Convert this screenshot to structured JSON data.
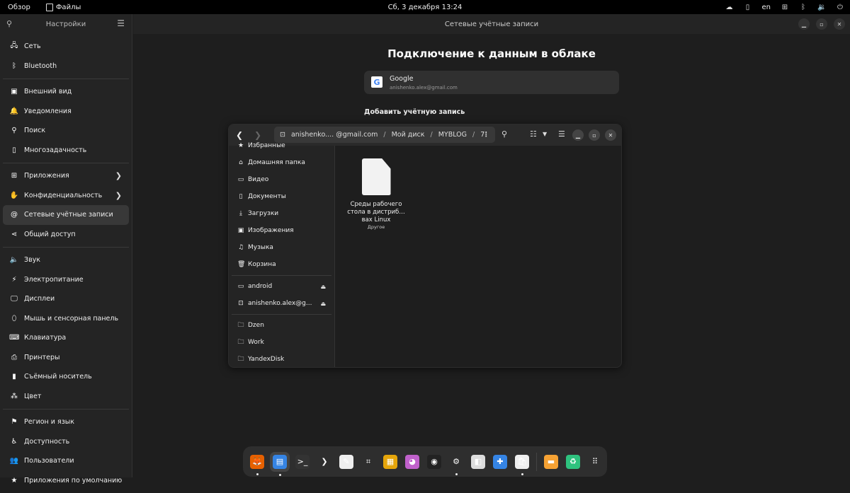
{
  "topbar": {
    "overview": "Обзор",
    "app_name": "Файлы",
    "clock": "Сб, 3 декабря  13:24",
    "lang": "en",
    "tray_icons": [
      "weather-icon",
      "clipboard-icon",
      "network-icon",
      "bluetooth-icon",
      "volume-icon",
      "power-icon"
    ]
  },
  "settings": {
    "title": "Настройки",
    "groups": [
      [
        {
          "label": "Сеть",
          "icon": "network-icon",
          "glyph": "🖧"
        },
        {
          "label": "Bluetooth",
          "icon": "bluetooth-icon",
          "glyph": "ᛒ"
        }
      ],
      [
        {
          "label": "Внешний вид",
          "icon": "appearance-icon",
          "glyph": "▣"
        },
        {
          "label": "Уведомления",
          "icon": "bell-icon",
          "glyph": "🔔"
        },
        {
          "label": "Поиск",
          "icon": "search-icon",
          "glyph": "⚲"
        },
        {
          "label": "Многозадачность",
          "icon": "multitasking-icon",
          "glyph": "▯"
        }
      ],
      [
        {
          "label": "Приложения",
          "icon": "apps-icon",
          "glyph": "⊞",
          "chevron": true
        },
        {
          "label": "Конфиденциальность",
          "icon": "hand-icon",
          "glyph": "✋",
          "chevron": true
        },
        {
          "label": "Сетевые учётные записи",
          "icon": "at-icon",
          "glyph": "@",
          "active": true
        },
        {
          "label": "Общий доступ",
          "icon": "share-icon",
          "glyph": "⋖"
        }
      ],
      [
        {
          "label": "Звук",
          "icon": "speaker-icon",
          "glyph": "🔈"
        },
        {
          "label": "Электропитание",
          "icon": "power-icon",
          "glyph": "⚡"
        },
        {
          "label": "Дисплеи",
          "icon": "display-icon",
          "glyph": "🖵"
        },
        {
          "label": "Мышь и сенсорная панель",
          "icon": "mouse-icon",
          "glyph": "⬯"
        },
        {
          "label": "Клавиатура",
          "icon": "keyboard-icon",
          "glyph": "⌨"
        },
        {
          "label": "Принтеры",
          "icon": "printer-icon",
          "glyph": "⎙"
        },
        {
          "label": "Съёмный носитель",
          "icon": "usb-icon",
          "glyph": "▮"
        },
        {
          "label": "Цвет",
          "icon": "color-icon",
          "glyph": "⁂"
        }
      ],
      [
        {
          "label": "Регион и язык",
          "icon": "flag-icon",
          "glyph": "⚑"
        },
        {
          "label": "Доступность",
          "icon": "accessibility-icon",
          "glyph": "♿"
        },
        {
          "label": "Пользователи",
          "icon": "users-icon",
          "glyph": "👥"
        },
        {
          "label": "Приложения по умолчанию",
          "icon": "star-icon",
          "glyph": "★"
        }
      ]
    ]
  },
  "main": {
    "header": "Сетевые учётные записи",
    "title": "Подключение к данным в облаке",
    "account": {
      "provider": "Google",
      "email": "anishenko.alex@gmail.com"
    },
    "add_label": "Добавить учётную запись"
  },
  "files": {
    "path": [
      "anishenko.... @gmail.com",
      "Мой диск",
      "MYBLOG",
      "7"
    ],
    "sidebar_top": [
      {
        "label": "Избранные",
        "icon": "star-icon",
        "glyph": "★"
      },
      {
        "label": "Домашняя папка",
        "icon": "home-icon",
        "glyph": "⌂"
      },
      {
        "label": "Видео",
        "icon": "video-icon",
        "glyph": "▭"
      },
      {
        "label": "Документы",
        "icon": "document-icon",
        "glyph": "▯"
      },
      {
        "label": "Загрузки",
        "icon": "download-icon",
        "glyph": "⤓"
      },
      {
        "label": "Изображения",
        "icon": "image-icon",
        "glyph": "▣"
      },
      {
        "label": "Музыка",
        "icon": "music-icon",
        "glyph": "♫"
      },
      {
        "label": "Корзина",
        "icon": "trash-icon",
        "glyph": "🗑"
      }
    ],
    "devices": [
      {
        "label": "android",
        "icon": "phone-icon",
        "glyph": "▭"
      },
      {
        "label": "anishenko.alex@g...",
        "icon": "network-drive-icon",
        "glyph": "⊡"
      }
    ],
    "bookmarks": [
      {
        "label": "Dzen",
        "icon": "folder-icon",
        "glyph": "🗀"
      },
      {
        "label": "Work",
        "icon": "folder-icon",
        "glyph": "🗀"
      },
      {
        "label": "YandexDisk",
        "icon": "folder-icon",
        "glyph": "🗀"
      }
    ],
    "file": {
      "name": "Среды рабочего стола в дистриб… вах Linux",
      "type": "Другое"
    }
  },
  "dock": [
    {
      "name": "firefox",
      "glyph": "🦊",
      "bg": "#e66000",
      "dot": true
    },
    {
      "name": "files",
      "glyph": "▤",
      "bg": "#3584e4",
      "dot": true,
      "active": true
    },
    {
      "name": "terminal",
      "glyph": ">_",
      "bg": "#333"
    },
    {
      "name": "vscode-like",
      "glyph": "❯",
      "bg": "transparent"
    },
    {
      "name": "text-editor",
      "glyph": "✎",
      "bg": "#eee"
    },
    {
      "name": "screenshot",
      "glyph": "⌗",
      "bg": "transparent"
    },
    {
      "name": "screen-recorder",
      "glyph": "▦",
      "bg": "#e5a50a"
    },
    {
      "name": "color-picker",
      "glyph": "◕",
      "bg": "#c061cb"
    },
    {
      "name": "obs",
      "glyph": "◉",
      "bg": "#222"
    },
    {
      "name": "settings",
      "glyph": "⚙",
      "bg": "transparent",
      "dot": true
    },
    {
      "name": "tweaks",
      "glyph": "◧",
      "bg": "#ddd"
    },
    {
      "name": "extensions",
      "glyph": "✚",
      "bg": "#3584e4"
    },
    {
      "name": "software",
      "glyph": "🛍",
      "bg": "#eee",
      "dot": true
    },
    {
      "name": "drive",
      "glyph": "▬",
      "bg": "#f6a234",
      "sep_before": true
    },
    {
      "name": "trash-app",
      "glyph": "♻",
      "bg": "#2ec27e"
    },
    {
      "name": "show-apps",
      "glyph": "⠿",
      "bg": "transparent"
    }
  ]
}
